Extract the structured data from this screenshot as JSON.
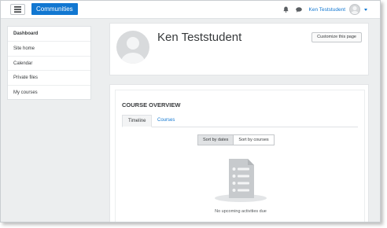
{
  "navbar": {
    "menu_icon": "hamburger-icon",
    "brand": "Communities",
    "notifications_icon": "bell-icon",
    "messages_icon": "chat-bubble-icon",
    "user_name": "Ken Teststudent",
    "user_menu_icon": "caret-down-icon"
  },
  "sidebar": {
    "items": [
      {
        "label": "Dashboard"
      },
      {
        "label": "Site home"
      },
      {
        "label": "Calendar"
      },
      {
        "label": "Private files"
      },
      {
        "label": "My courses"
      }
    ]
  },
  "profile": {
    "name": "Ken Teststudent",
    "customize_label": "Customize this page"
  },
  "course_overview": {
    "title": "COURSE OVERVIEW",
    "tabs": [
      {
        "label": "Timeline",
        "active": true
      },
      {
        "label": "Courses",
        "active": false
      }
    ],
    "sort_buttons": [
      {
        "label": "Sort by dates",
        "active": true
      },
      {
        "label": "Sort by courses",
        "active": false
      }
    ],
    "empty_icon": "document-list-icon",
    "empty_message": "No upcoming activities due"
  },
  "colors": {
    "accent": "#1177d1",
    "page_bg": "#eceeef",
    "text": "#373a3c"
  }
}
